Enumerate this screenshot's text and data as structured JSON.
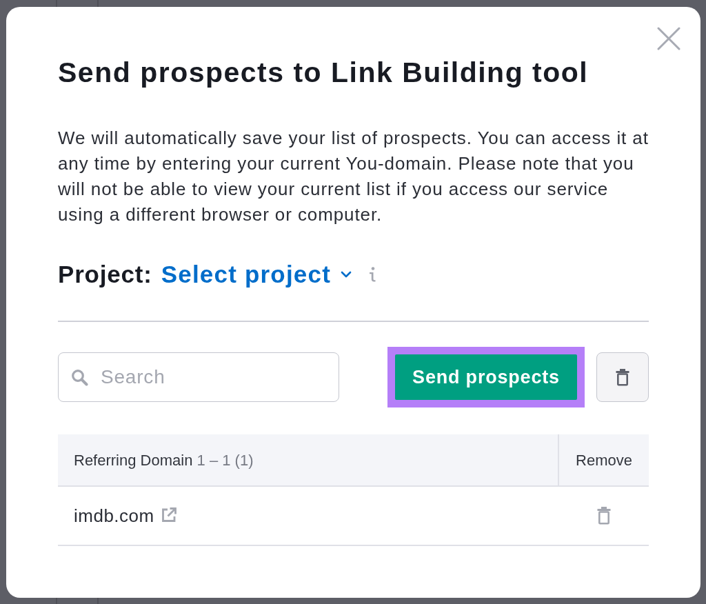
{
  "dialog": {
    "title": "Send prospects to Link Building tool",
    "description": "We will automatically save your list of prospects. You can access it at any time by entering your current You-domain. Please note that you will not be able to view your current list if you access our service using a different browser or computer.",
    "project": {
      "label": "Project:",
      "value": "Select project"
    },
    "search": {
      "placeholder": "Search"
    },
    "send_button": {
      "label": "Send prospects",
      "highlighted": true
    },
    "table": {
      "columns": [
        {
          "label": "Referring Domain",
          "count": "1 – 1 (1)"
        },
        {
          "label": "Remove"
        }
      ],
      "rows": [
        {
          "domain": "imdb.com"
        }
      ]
    }
  }
}
